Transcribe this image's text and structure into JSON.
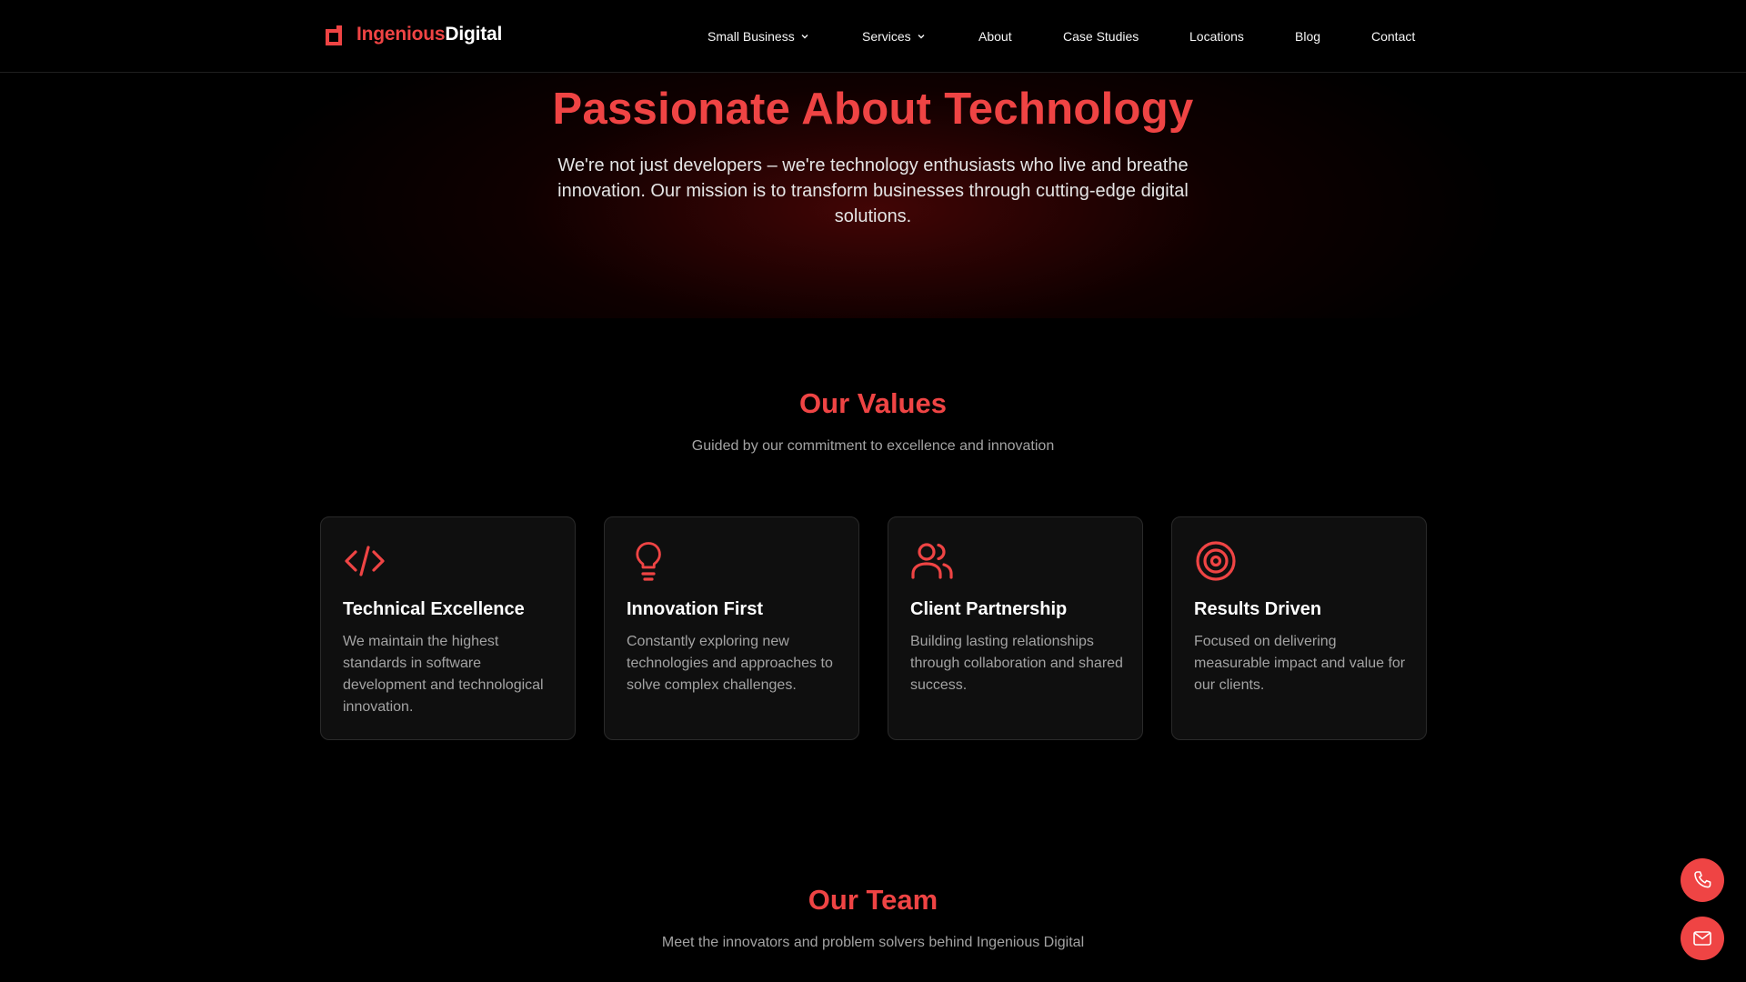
{
  "brand": {
    "name_part1": "Ingenious",
    "name_part2": "Digital",
    "accent": "#ef4444"
  },
  "nav": {
    "items": [
      {
        "label": "Small Business",
        "has_dropdown": true
      },
      {
        "label": "Services",
        "has_dropdown": true
      },
      {
        "label": "About",
        "has_dropdown": false
      },
      {
        "label": "Case Studies",
        "has_dropdown": false
      },
      {
        "label": "Locations",
        "has_dropdown": false
      },
      {
        "label": "Blog",
        "has_dropdown": false
      },
      {
        "label": "Contact",
        "has_dropdown": false
      }
    ]
  },
  "hero": {
    "title": "Passionate About Technology",
    "subtitle": "We're not just developers – we're technology enthusiasts who live and breathe innovation. Our mission is to transform businesses through cutting-edge digital solutions."
  },
  "values": {
    "title": "Our Values",
    "subtitle": "Guided by our commitment to excellence and innovation",
    "cards": [
      {
        "icon": "code-icon",
        "title": "Technical Excellence",
        "description": "We maintain the highest standards in software development and technological innovation."
      },
      {
        "icon": "lightbulb-icon",
        "title": "Innovation First",
        "description": "Constantly exploring new technologies and approaches to solve complex challenges."
      },
      {
        "icon": "users-icon",
        "title": "Client Partnership",
        "description": "Building lasting relationships through collaboration and shared success."
      },
      {
        "icon": "target-icon",
        "title": "Results Driven",
        "description": "Focused on delivering measurable impact and value for our clients."
      }
    ]
  },
  "team": {
    "title": "Our Team",
    "subtitle": "Meet the innovators and problem solvers behind Ingenious Digital"
  },
  "floating_actions": [
    {
      "icon": "phone-icon"
    },
    {
      "icon": "mail-icon"
    }
  ]
}
